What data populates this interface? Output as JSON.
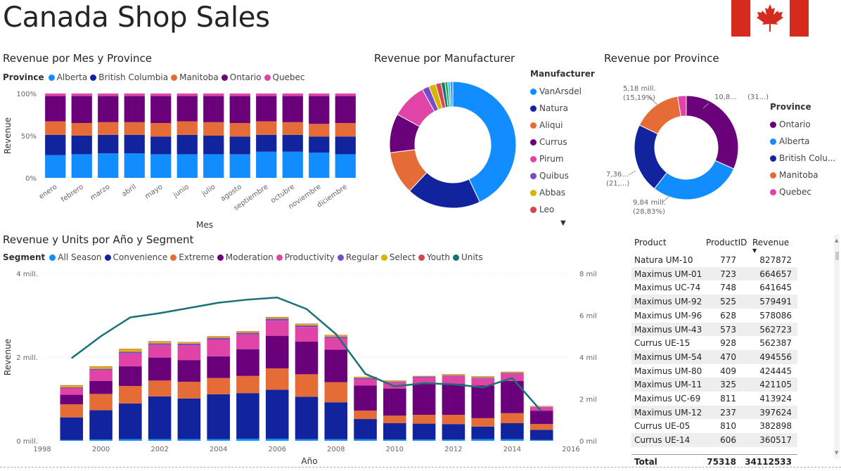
{
  "page": {
    "title": "Canada Shop Sales"
  },
  "colors": {
    "alberta": "#118DFF",
    "british_columbia": "#12239E",
    "manitoba": "#E66C37",
    "ontario": "#6B007B",
    "quebec": "#E044A7",
    "vanarsdel": "#118DFF",
    "natura": "#12239E",
    "aliqui": "#E66C37",
    "currus": "#6B007B",
    "pirum": "#E044A7",
    "quibus": "#744EC2",
    "abbas": "#D9B300",
    "leo": "#D64550",
    "units_line": "#197278",
    "flag_red": "#D52B1E"
  },
  "chart_data": [
    {
      "id": "revenue_mes_province",
      "type": "bar",
      "stacked": "100%",
      "title": "Revenue por Mes y Province",
      "xlabel": "Mes",
      "ylabel": "Revenue",
      "legend_title": "Province",
      "yticks": [
        "100%",
        "50%",
        "0%"
      ],
      "categories": [
        "enero",
        "febrero",
        "marzo",
        "abril",
        "mayo",
        "junio",
        "julio",
        "agosto",
        "septiembre",
        "octubre",
        "noviembre",
        "diciembre"
      ],
      "series": [
        {
          "name": "Alberta",
          "color": "#118DFF",
          "values": [
            27,
            28,
            29,
            29,
            28,
            28,
            28,
            28,
            31,
            31,
            30,
            28
          ]
        },
        {
          "name": "British Columbia",
          "color": "#12239E",
          "values": [
            24,
            22,
            22,
            22,
            21,
            23,
            22,
            21,
            20,
            20,
            19,
            21
          ]
        },
        {
          "name": "Manitoba",
          "color": "#E66C37",
          "values": [
            16,
            15,
            15,
            15,
            16,
            16,
            16,
            16,
            16,
            15,
            15,
            16
          ]
        },
        {
          "name": "Ontario",
          "color": "#6B007B",
          "values": [
            30,
            32,
            31,
            31,
            32,
            30,
            31,
            32,
            30,
            31,
            33,
            32
          ]
        },
        {
          "name": "Quebec",
          "color": "#E044A7",
          "values": [
            3,
            3,
            3,
            3,
            3,
            3,
            3,
            3,
            3,
            3,
            3,
            3
          ]
        }
      ]
    },
    {
      "id": "revenue_manufacturer",
      "type": "pie",
      "donut": true,
      "title": "Revenue por Manufacturer",
      "legend_title": "Manufacturer",
      "slices": [
        {
          "name": "VanArsdel",
          "color": "#118DFF",
          "value": 43
        },
        {
          "name": "Natura",
          "color": "#12239E",
          "value": 19
        },
        {
          "name": "Aliqui",
          "color": "#E66C37",
          "value": 11
        },
        {
          "name": "Currus",
          "color": "#6B007B",
          "value": 10
        },
        {
          "name": "Pirum",
          "color": "#E044A7",
          "value": 9
        },
        {
          "name": "Quibus",
          "color": "#744EC2",
          "value": 1.8
        },
        {
          "name": "Abbas",
          "color": "#D9B300",
          "value": 1.8
        },
        {
          "name": "Leo",
          "color": "#D64550",
          "value": 1.4
        },
        {
          "name": "",
          "color": "#197278",
          "value": 1.0
        },
        {
          "name": "",
          "color": "#1AAB40",
          "value": 0.7
        },
        {
          "name": "",
          "color": "#15C6F4",
          "value": 0.6
        },
        {
          "name": "",
          "color": "#4092FF",
          "value": 0.7
        }
      ]
    },
    {
      "id": "revenue_province",
      "type": "pie",
      "donut": true,
      "title": "Revenue por Province",
      "legend_title": "Province",
      "slices": [
        {
          "name": "Ontario",
          "color": "#6B007B",
          "value": 31.7,
          "label1": "10,8...",
          "label2": "(31...)"
        },
        {
          "name": "Alberta",
          "color": "#118DFF",
          "value": 28.83,
          "label1": "9,84 mill.",
          "label2": "(28,83%)"
        },
        {
          "name": "British Columbia",
          "legend": "British Colu...",
          "color": "#12239E",
          "value": 21.6,
          "label1": "7,36...",
          "label2": "(21,...)"
        },
        {
          "name": "Manitoba",
          "color": "#E66C37",
          "value": 15.19,
          "label1": "5,18 mill.",
          "label2": "(15,19%)"
        },
        {
          "name": "Quebec",
          "color": "#E044A7",
          "value": 2.68,
          "label1": "",
          "label2": ""
        }
      ]
    },
    {
      "id": "revenue_units_year_segment",
      "type": "bar",
      "stacked": true,
      "title": "Revenue y Units por Año y Segment",
      "xlabel": "Año",
      "ylabel": "Revenue",
      "legend_title": "Segment",
      "ylim": [
        0,
        4000000
      ],
      "y2lim": [
        0,
        8000
      ],
      "yticks": [
        {
          "v": 0,
          "t": "0 mill."
        },
        {
          "v": 2000000,
          "t": "2 mill."
        },
        {
          "v": 4000000,
          "t": "4 mill."
        }
      ],
      "y2ticks": [
        {
          "v": 0,
          "t": "0 mil"
        },
        {
          "v": 2000,
          "t": "2 mil"
        },
        {
          "v": 4000,
          "t": "4 mil"
        },
        {
          "v": 6000,
          "t": "6 mil"
        },
        {
          "v": 8000,
          "t": "8 mil"
        }
      ],
      "xlim": [
        1998,
        2016
      ],
      "xticks": [
        1998,
        2000,
        2002,
        2004,
        2006,
        2008,
        2010,
        2012,
        2014,
        2016
      ],
      "x": [
        1999,
        2000,
        2001,
        2002,
        2003,
        2004,
        2005,
        2006,
        2007,
        2008,
        2009,
        2010,
        2011,
        2012,
        2013,
        2014,
        2015
      ],
      "series": [
        {
          "name": "All Season",
          "color": "#118DFF",
          "values": [
            20000,
            30000,
            40000,
            40000,
            40000,
            40000,
            50000,
            50000,
            40000,
            40000,
            40000,
            30000,
            30000,
            30000,
            40000,
            40000,
            20000
          ]
        },
        {
          "name": "Convenience",
          "color": "#12239E",
          "values": [
            540000,
            700000,
            850000,
            1020000,
            970000,
            1070000,
            1090000,
            1170000,
            1010000,
            880000,
            480000,
            390000,
            380000,
            370000,
            300000,
            380000,
            240000
          ]
        },
        {
          "name": "Extreme",
          "color": "#E66C37",
          "values": [
            310000,
            390000,
            420000,
            380000,
            400000,
            390000,
            410000,
            510000,
            540000,
            480000,
            200000,
            180000,
            210000,
            220000,
            200000,
            240000,
            140000
          ]
        },
        {
          "name": "Moderation",
          "color": "#6B007B",
          "values": [
            230000,
            310000,
            470000,
            550000,
            520000,
            520000,
            640000,
            780000,
            780000,
            780000,
            600000,
            650000,
            750000,
            740000,
            780000,
            770000,
            320000
          ]
        },
        {
          "name": "Productivity",
          "color": "#E044A7",
          "values": [
            160000,
            260000,
            310000,
            300000,
            350000,
            400000,
            350000,
            360000,
            350000,
            280000,
            150000,
            140000,
            140000,
            180000,
            170000,
            170000,
            80000
          ]
        },
        {
          "name": "Regular",
          "color": "#744EC2",
          "values": [
            20000,
            30000,
            40000,
            40000,
            40000,
            40000,
            40000,
            50000,
            40000,
            30000,
            30000,
            20000,
            20000,
            20000,
            20000,
            20000,
            10000
          ]
        },
        {
          "name": "Select",
          "color": "#D9B300",
          "values": [
            40000,
            50000,
            60000,
            40000,
            30000,
            30000,
            30000,
            30000,
            30000,
            30000,
            20000,
            20000,
            10000,
            20000,
            20000,
            20000,
            10000
          ]
        },
        {
          "name": "Youth",
          "color": "#D64550",
          "values": [
            10000,
            10000,
            10000,
            10000,
            10000,
            10000,
            10000,
            10000,
            10000,
            10000,
            10000,
            10000,
            10000,
            10000,
            10000,
            10000,
            10000
          ]
        }
      ],
      "line": {
        "name": "Units",
        "color": "#197278",
        "axis": "right",
        "values": [
          3950,
          5000,
          5900,
          6100,
          6350,
          6600,
          6750,
          6850,
          6300,
          5100,
          3200,
          2600,
          2750,
          2700,
          2550,
          3000,
          1400
        ]
      }
    }
  ],
  "table": {
    "headers": [
      "Product",
      "ProductID",
      "Revenue"
    ],
    "rows": [
      [
        "Natura UM-10",
        "777",
        "827872"
      ],
      [
        "Maximus UM-01",
        "723",
        "664657"
      ],
      [
        "Maximus UC-74",
        "748",
        "641645"
      ],
      [
        "Maximus UM-92",
        "525",
        "579491"
      ],
      [
        "Maximus UM-96",
        "628",
        "578086"
      ],
      [
        "Maximus UM-43",
        "573",
        "562723"
      ],
      [
        "Currus UE-15",
        "928",
        "562387"
      ],
      [
        "Maximus UM-54",
        "470",
        "494556"
      ],
      [
        "Maximus UM-80",
        "409",
        "424445"
      ],
      [
        "Maximus UM-11",
        "325",
        "421105"
      ],
      [
        "Maximus UC-69",
        "811",
        "413924"
      ],
      [
        "Maximus UM-12",
        "237",
        "397624"
      ],
      [
        "Currus UE-05",
        "810",
        "382898"
      ],
      [
        "Currus UE-14",
        "606",
        "360517"
      ]
    ],
    "total": [
      "Total",
      "75318",
      "34112533"
    ]
  }
}
